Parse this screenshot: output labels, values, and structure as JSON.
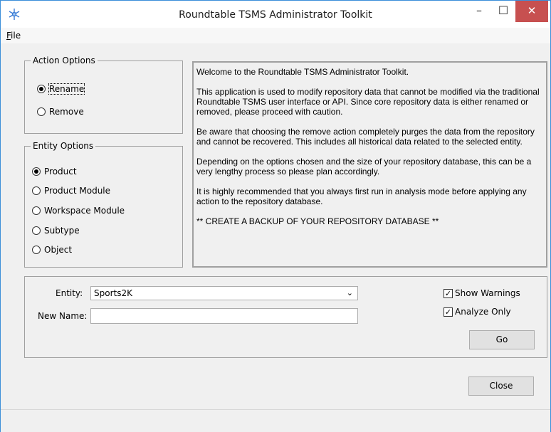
{
  "window": {
    "title": "Roundtable TSMS Administrator Toolkit",
    "minimize_glyph": "–",
    "maximize_glyph": "☐",
    "close_glyph": "✕",
    "app_icon": "snowflake-app-icon",
    "close_color": "#c75050"
  },
  "menu": {
    "file_hotkey": "F",
    "file_rest": "ile"
  },
  "action_options": {
    "legend": "Action Options",
    "items": [
      {
        "label": "Rename",
        "selected": true
      },
      {
        "label": "Remove",
        "selected": false
      }
    ]
  },
  "entity_options": {
    "legend": "Entity Options",
    "items": [
      {
        "label": "Product",
        "selected": true
      },
      {
        "label": "Product Module",
        "selected": false
      },
      {
        "label": "Workspace Module",
        "selected": false
      },
      {
        "label": "Subtype",
        "selected": false
      },
      {
        "label": "Object",
        "selected": false
      }
    ]
  },
  "message": [
    "Welcome to the Roundtable TSMS Administrator Toolkit.",
    "This application is used to modify repository data that cannot be modified via the traditional Roundtable TSMS user interface or API. Since core repository data is either renamed or removed, please proceed with caution.",
    "Be aware that choosing the remove action completely purges the data from the repository and cannot be recovered. This includes all historical data related to the selected entity.",
    "Depending on the options chosen and the size of your repository database, this can be a very lengthy process so please plan accordingly.",
    "It is highly recommended that you always first run in analysis mode before applying any action to the repository database.",
    "** CREATE A BACKUP OF YOUR REPOSITORY DATABASE **"
  ],
  "form": {
    "entity_label": "Entity:",
    "entity_value": "Sports2K",
    "new_name_label": "New Name:",
    "new_name_value": "",
    "show_warnings_label": "Show Warnings",
    "show_warnings_checked": true,
    "analyze_only_label": "Analyze Only",
    "analyze_only_checked": true,
    "go_label": "Go"
  },
  "close_label": "Close"
}
